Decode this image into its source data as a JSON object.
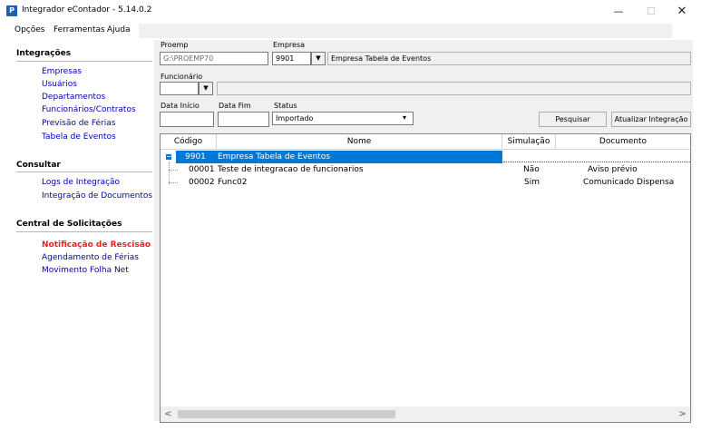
{
  "window": {
    "app_icon": "P",
    "title": "Integrador eContador - 5.14.0.2",
    "minimize": "—",
    "maximize": "☐",
    "close": "✕"
  },
  "menu": [
    "Opções",
    "Ferramentas",
    "Ajuda"
  ],
  "sidebar": {
    "sections": [
      {
        "header": "Integrações",
        "items": [
          "Empresas",
          "Usuários",
          "Departamentos",
          "Funcionários/Contratos",
          "Previsão de Férias",
          "Tabela de Eventos"
        ]
      },
      {
        "header": "Consultar",
        "items": [
          "Logs de Integração",
          "Integração de Documentos"
        ]
      },
      {
        "header": "Central de Solicitações",
        "items": [
          "Notificação de Rescisão",
          "Agendamento de Férias",
          "Movimento Folha Net"
        ]
      }
    ]
  },
  "form": {
    "proemp_label": "Proemp",
    "proemp_value": "G:\\PROEMP70",
    "empresa_label": "Empresa",
    "empresa_code": "9901",
    "empresa_name": "Empresa Tabela de Eventos",
    "funcionario_label": "Funcionário",
    "funcionario_value": "",
    "funcionario_name": "",
    "data_inicio_label": "Data Início",
    "data_inicio_value": "",
    "data_fim_label": "Data Fim",
    "data_fim_value": "",
    "status_label": "Status",
    "status_value": "Importado",
    "pesquisar_label": "Pesquisar",
    "atualizar_label": "Atualizar Integração"
  },
  "grid": {
    "columns": [
      "Código",
      "Nome",
      "Simulação",
      "Documento"
    ],
    "group": {
      "code": "9901",
      "name": "Empresa Tabela de Eventos",
      "toggle": "−"
    },
    "rows": [
      {
        "code": "00001",
        "name": "Teste de integracao de funcionarios",
        "simulacao": "Não",
        "documento": "Aviso prévio"
      },
      {
        "code": "00002",
        "name": "Func02",
        "simulacao": "Sim",
        "documento": "Comunicado Dispensa"
      }
    ],
    "scroll_left": "<",
    "scroll_right": ">"
  },
  "colors": {
    "link": "#0000b4",
    "alert_link": "#ff1a1a",
    "selection": "#0078d7",
    "panel": "#f0f0f0"
  }
}
